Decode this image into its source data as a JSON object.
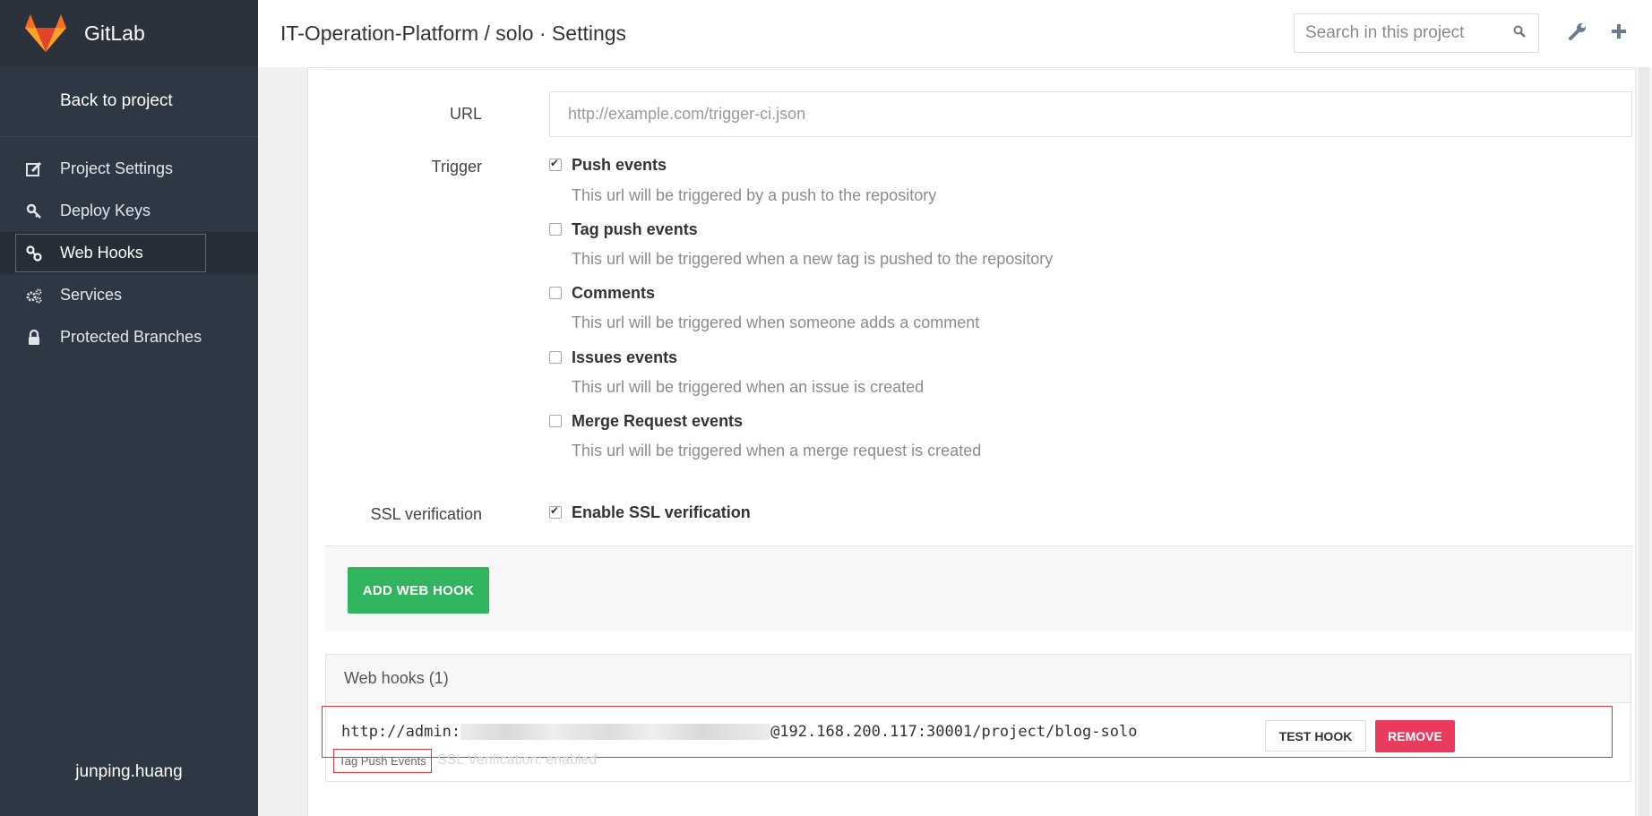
{
  "app": {
    "name": "GitLab"
  },
  "colors": {
    "sidebar": "#2e3844",
    "accent_green": "#31b45e",
    "danger": "#ea3a5d",
    "highlight": "#e0343a"
  },
  "sidebar": {
    "back_label": "Back to project",
    "items": [
      {
        "label": "Project Settings",
        "icon": "edit-icon"
      },
      {
        "label": "Deploy Keys",
        "icon": "key-icon"
      },
      {
        "label": "Web Hooks",
        "icon": "link-icon",
        "active": true
      },
      {
        "label": "Services",
        "icon": "gears-icon"
      },
      {
        "label": "Protected Branches",
        "icon": "lock-icon"
      }
    ],
    "user": "junping.huang"
  },
  "header": {
    "title": "IT-Operation-Platform / solo · Settings",
    "search_placeholder": "Search in this project"
  },
  "form": {
    "url_label": "URL",
    "url_placeholder": "http://example.com/trigger-ci.json",
    "trigger_label": "Trigger",
    "triggers": [
      {
        "label": "Push events",
        "desc": "This url will be triggered by a push to the repository",
        "checked": true
      },
      {
        "label": "Tag push events",
        "desc": "This url will be triggered when a new tag is pushed to the repository",
        "checked": false
      },
      {
        "label": "Comments",
        "desc": "This url will be triggered when someone adds a comment",
        "checked": false
      },
      {
        "label": "Issues events",
        "desc": "This url will be triggered when an issue is created",
        "checked": false
      },
      {
        "label": "Merge Request events",
        "desc": "This url will be triggered when a merge request is created",
        "checked": false
      }
    ],
    "ssl_label": "SSL verification",
    "ssl_option": "Enable SSL verification",
    "ssl_checked": true,
    "add_button": "ADD WEB HOOK"
  },
  "hooks": {
    "heading": "Web hooks (1)",
    "items": [
      {
        "url_prefix": "http://admin:",
        "url_suffix": "@192.168.200.117:30001/project/blog-solo",
        "badge": "Tag Push Events",
        "ssl_note": "SSL Verification: enabled",
        "test_label": "TEST HOOK",
        "remove_label": "REMOVE"
      }
    ]
  }
}
